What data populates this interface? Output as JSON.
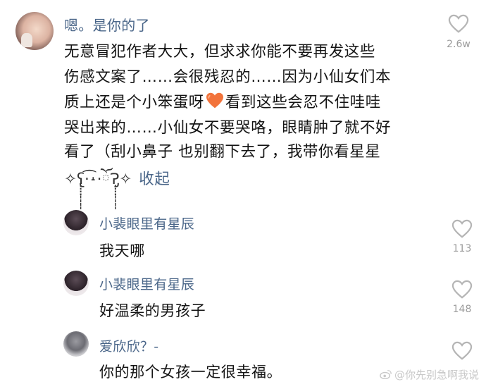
{
  "main_comment": {
    "username": "嗯。是你的了",
    "lines": [
      "无意冒犯作者大大，但求求你能不要再发这些",
      "伤感文案了……会很残忍的……因为小仙女们本",
      "质上还是个小笨蛋呀",
      "看到这些会忍不住哇哇",
      "哭出来的……小仙女不要哭咯，眼睛肿了就不好",
      "看了（刮小鼻子 也别翻下去了，我带你看星星"
    ],
    "kaomoji": "✧ʕ̢̣̣̣̣̩̩̩̩·͡˔·ོɁ̡̣̣̣̣̩̩̩̩✧",
    "collapse_label": "收起",
    "like_count": "2.6w",
    "emoji_icon": "orange-heart-icon"
  },
  "replies": [
    {
      "username": "小裴眼里有星辰",
      "text": "我天哪",
      "like_count": "113"
    },
    {
      "username": "小裴眼里有星辰",
      "text": "好温柔的男孩子",
      "like_count": "148"
    },
    {
      "username": "爱欣欣？-",
      "text": "你的那个女孩一定很幸福。",
      "like_count": ""
    }
  ],
  "watermark": {
    "text": "@你先别急啊我说",
    "icon": "weibo-logo-icon"
  },
  "colors": {
    "username": "#4a6689",
    "heart_outline": "#b5b5b5",
    "emoji_heart": "#f2733b",
    "like_count": "#9b9b9b"
  }
}
